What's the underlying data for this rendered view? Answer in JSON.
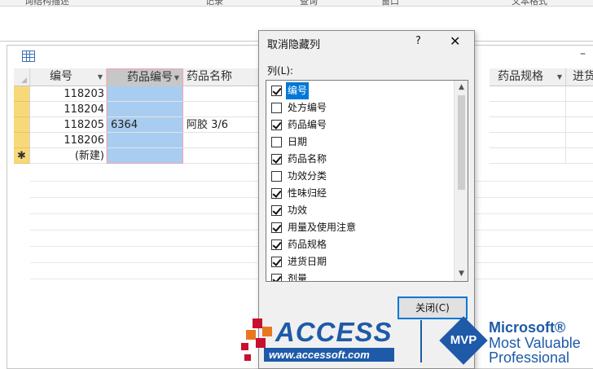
{
  "ribbon": {
    "fragments": [
      "询结构描述",
      "记录",
      "查询",
      "窗口",
      "文本格式"
    ]
  },
  "datasheet": {
    "minimize_label": "–",
    "columns": [
      {
        "label": "编号"
      },
      {
        "label": "药品编号"
      },
      {
        "label": "药品名称"
      },
      {
        "label": "药品规格"
      },
      {
        "label": "进货"
      }
    ],
    "rows": [
      {
        "selector": "",
        "id": "118203",
        "drug_no": "",
        "drug_name": ""
      },
      {
        "selector": "",
        "id": "118204",
        "drug_no": "",
        "drug_name": ""
      },
      {
        "selector": "",
        "id": "118205",
        "drug_no": "6364",
        "drug_name": "阿胶 3/6"
      },
      {
        "selector": "",
        "id": "118206",
        "drug_no": "",
        "drug_name": ""
      },
      {
        "selector": "✱",
        "id": "(新建)",
        "drug_no": "",
        "drug_name": ""
      }
    ]
  },
  "dialog": {
    "title": "取消隐藏列",
    "help": "?",
    "close": "✕",
    "list_label": "列(L):",
    "close_button": "关闭(C)",
    "items": [
      {
        "label": "编号",
        "checked": true
      },
      {
        "label": "处方编号",
        "checked": false
      },
      {
        "label": "药品编号",
        "checked": true
      },
      {
        "label": "日期",
        "checked": false
      },
      {
        "label": "药品名称",
        "checked": true
      },
      {
        "label": "功效分类",
        "checked": false
      },
      {
        "label": "性味归经",
        "checked": true
      },
      {
        "label": "功效",
        "checked": true
      },
      {
        "label": "用量及使用注意",
        "checked": true
      },
      {
        "label": "药品规格",
        "checked": true
      },
      {
        "label": "进货日期",
        "checked": true
      },
      {
        "label": "剂量",
        "checked": true
      }
    ]
  },
  "watermark": {
    "brand": "ACCESS",
    "url": "www.accessoft.com",
    "mvp": "MVP",
    "ms_line1": "Microsoft®",
    "ms_line2": "Most Valuable",
    "ms_line3": "Professional"
  },
  "colors": {
    "selected_column": "#a8cdf0",
    "record_selector": "#f8d97a",
    "focus_highlight": "#0078d7",
    "logo_blue": "#1e5aa8"
  }
}
